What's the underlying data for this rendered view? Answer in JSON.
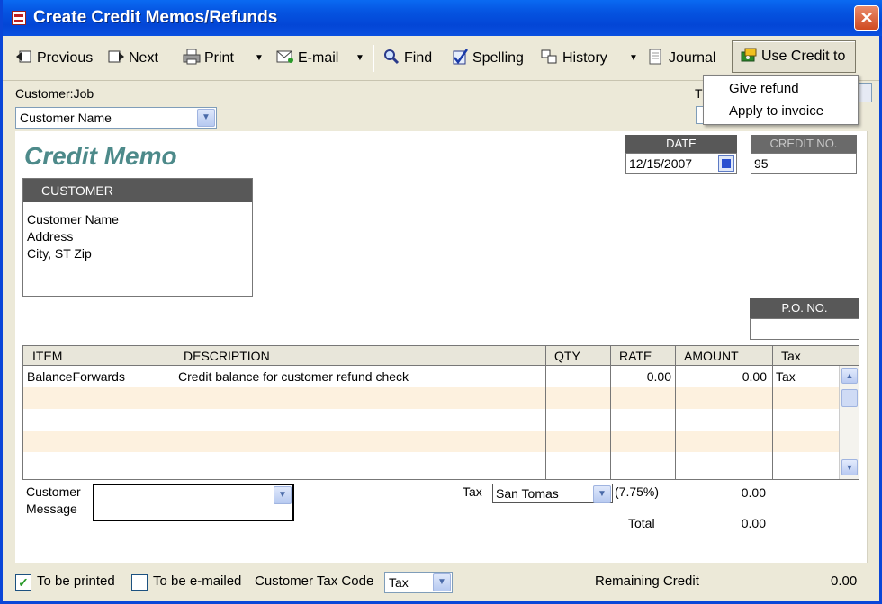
{
  "window": {
    "title": "Create Credit Memos/Refunds",
    "close_glyph": "✕"
  },
  "toolbar": {
    "previous": "Previous",
    "next": "Next",
    "print": "Print",
    "email": "E-mail",
    "find": "Find",
    "spelling": "Spelling",
    "history": "History",
    "journal": "Journal",
    "use_credit": "Use Credit to",
    "dropdown_glyph": "▼"
  },
  "menu": {
    "items": [
      "Give refund",
      "Apply to invoice"
    ]
  },
  "customer_job": {
    "label": "Customer:Job",
    "value": "Customer Name",
    "peek_letter": "T"
  },
  "form": {
    "title": "Credit Memo",
    "date": {
      "label": "DATE",
      "value": "12/15/2007"
    },
    "credit_no": {
      "label": "CREDIT NO.",
      "value": "95"
    },
    "customer": {
      "label": "CUSTOMER",
      "lines": [
        "Customer Name",
        "Address",
        "City, ST Zip"
      ]
    },
    "po_no": {
      "label": "P.O. NO.",
      "value": ""
    }
  },
  "items_table": {
    "headers": [
      "ITEM",
      "DESCRIPTION",
      "QTY",
      "RATE",
      "AMOUNT",
      "Tax"
    ],
    "rows": [
      {
        "item": "BalanceForwards",
        "description": "Credit balance for customer refund check",
        "qty": "",
        "rate": "0.00",
        "amount": "0.00",
        "tax": "Tax"
      }
    ]
  },
  "summary": {
    "customer_message_label_1": "Customer",
    "customer_message_label_2": "Message",
    "tax_label": "Tax",
    "tax_item": "San Tomas",
    "tax_rate": "(7.75%)",
    "tax_amount": "0.00",
    "total_label": "Total",
    "total_amount": "0.00"
  },
  "footer": {
    "to_be_printed": "To be printed",
    "to_be_printed_checked": true,
    "to_be_emailed": "To be e-mailed",
    "customer_tax_code_label": "Customer Tax Code",
    "customer_tax_code_value": "Tax",
    "remaining_credit_label": "Remaining Credit",
    "remaining_credit_value": "0.00",
    "check_glyph": "✓"
  },
  "colors": {
    "title_bar": "#0553e0",
    "form_title": "#4d8a8a",
    "header_fill": "#585858",
    "row_alt": "#fdf1df"
  }
}
